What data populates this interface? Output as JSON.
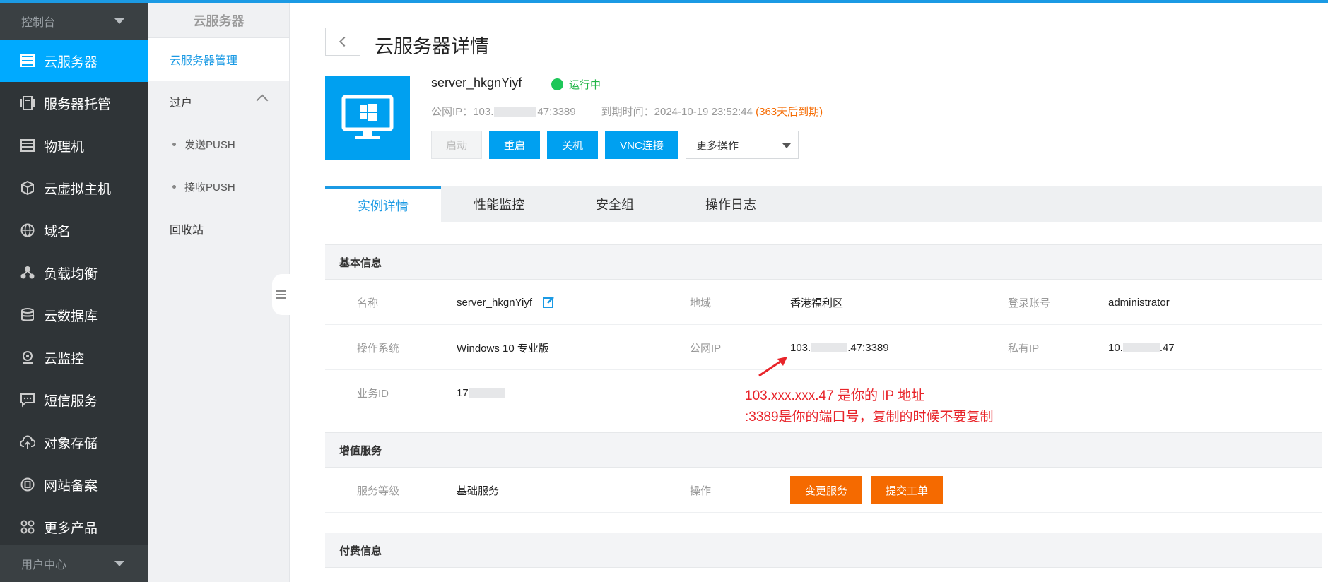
{
  "sidebar": {
    "section_top": "控制台",
    "section_bottom": "用户中心",
    "items": [
      {
        "label": "云服务器",
        "icon": "server-icon"
      },
      {
        "label": "服务器托管",
        "icon": "hosting-icon"
      },
      {
        "label": "物理机",
        "icon": "list-icon"
      },
      {
        "label": "云虚拟主机",
        "icon": "cube-icon"
      },
      {
        "label": "域名",
        "icon": "globe-icon"
      },
      {
        "label": "负载均衡",
        "icon": "balance-icon"
      },
      {
        "label": "云数据库",
        "icon": "database-icon"
      },
      {
        "label": "云监控",
        "icon": "monitor-icon"
      },
      {
        "label": "短信服务",
        "icon": "sms-icon"
      },
      {
        "label": "对象存储",
        "icon": "cloud-upload-icon"
      },
      {
        "label": "网站备案",
        "icon": "record-icon"
      },
      {
        "label": "更多产品",
        "icon": "grid-icon"
      }
    ]
  },
  "submenu": {
    "title": "云服务器",
    "items": [
      "云服务器管理",
      "过户",
      "发送PUSH",
      "接收PUSH",
      "回收站"
    ]
  },
  "header": {
    "title": "云服务器详情"
  },
  "server": {
    "name": "server_hkgnYiyf",
    "status": "运行中",
    "public_ip_label": "公网IP：",
    "public_ip_prefix": "103.",
    "public_ip_suffix": "47:3389",
    "expire_label": "到期时间：",
    "expire_time": "2024-10-19 23:52:44",
    "expire_note": "(363天后到期)"
  },
  "actions": {
    "start": "启动",
    "restart": "重启",
    "shutdown": "关机",
    "vnc": "VNC连接",
    "more": "更多操作"
  },
  "tabs": [
    "实例详情",
    "性能监控",
    "安全组",
    "操作日志"
  ],
  "basic": {
    "heading": "基本信息",
    "name_label": "名称",
    "name_value": "server_hkgnYiyf",
    "region_label": "地域",
    "region_value": "香港福利区",
    "account_label": "登录账号",
    "account_value": "administrator",
    "os_label": "操作系统",
    "os_value": "Windows 10 专业版",
    "pubip_label": "公网IP",
    "pubip_prefix": "103.",
    "pubip_suffix": ".47:3389",
    "privip_label": "私有IP",
    "privip_prefix": "10.",
    "privip_suffix": ".47",
    "bizid_label": "业务ID",
    "bizid_value": "17"
  },
  "value_added": {
    "heading": "增值服务",
    "level_label": "服务等级",
    "level_value": "基础服务",
    "op_label": "操作",
    "change_btn": "变更服务",
    "ticket_btn": "提交工单"
  },
  "billing": {
    "heading": "付费信息"
  },
  "annotation": {
    "line1": "103.xxx.xxx.47 是你的 IP 地址",
    "line2": ":3389是你的端口号，复制的时候不要复制"
  },
  "colors": {
    "accent": "#00a0f0",
    "sidebar_bg": "#2f3437",
    "orange": "#f56a00",
    "running": "#1ec759",
    "annotation": "#e8242a"
  }
}
